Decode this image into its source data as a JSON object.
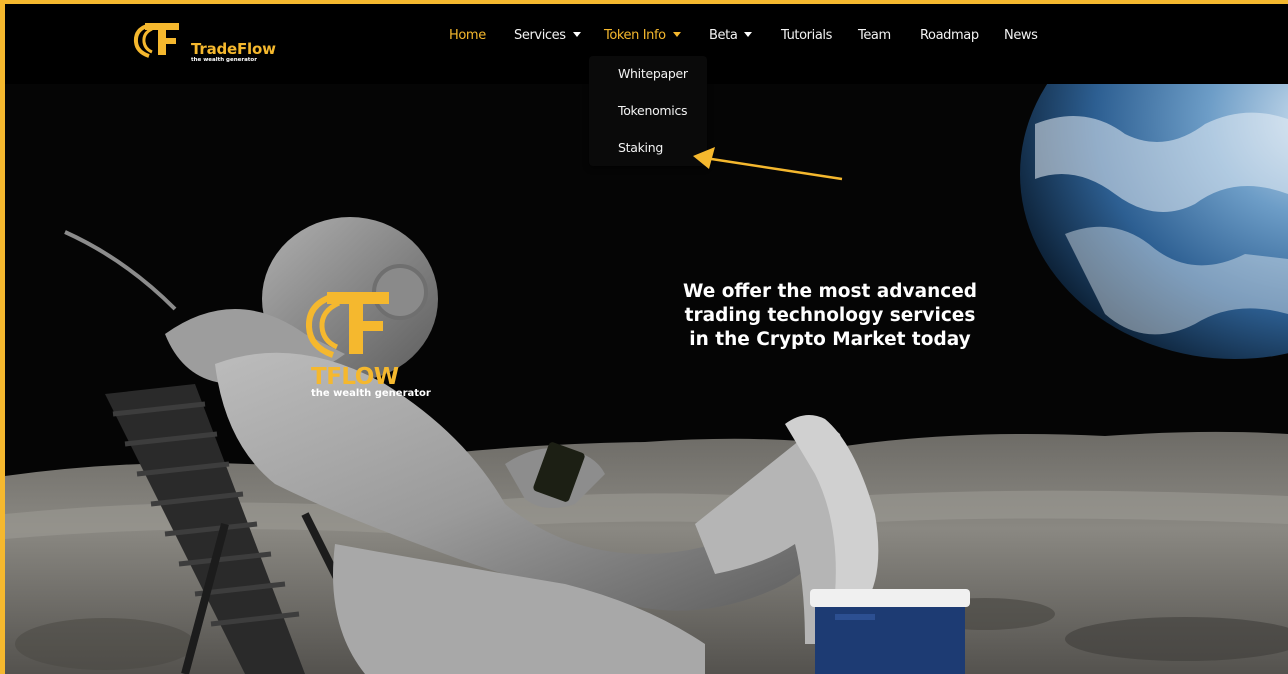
{
  "brand": {
    "name": "TradeFlow",
    "tagline": "the wealth generator",
    "accent_color": "#f5b82e"
  },
  "nav": {
    "items": [
      {
        "label": "Home",
        "active": true,
        "has_dropdown": false
      },
      {
        "label": "Services",
        "active": false,
        "has_dropdown": true
      },
      {
        "label": "Token Info",
        "active": false,
        "has_dropdown": true,
        "open": true
      },
      {
        "label": "Beta",
        "active": false,
        "has_dropdown": true
      },
      {
        "label": "Tutorials",
        "active": false,
        "has_dropdown": false
      },
      {
        "label": "Team",
        "active": false,
        "has_dropdown": false
      },
      {
        "label": "Roadmap",
        "active": false,
        "has_dropdown": false
      },
      {
        "label": "News",
        "active": false,
        "has_dropdown": false
      }
    ]
  },
  "token_info_dropdown": {
    "items": [
      "Whitepaper",
      "Tokenomics",
      "Staking"
    ]
  },
  "hero": {
    "headline_lines": [
      "We offer the most advanced",
      "trading technology services",
      "in the Crypto Market today"
    ],
    "logo_text": "TFLOW",
    "logo_tagline": "the wealth generator"
  },
  "annotation": {
    "arrow_color": "#f5b82e",
    "points_to": "Staking"
  }
}
